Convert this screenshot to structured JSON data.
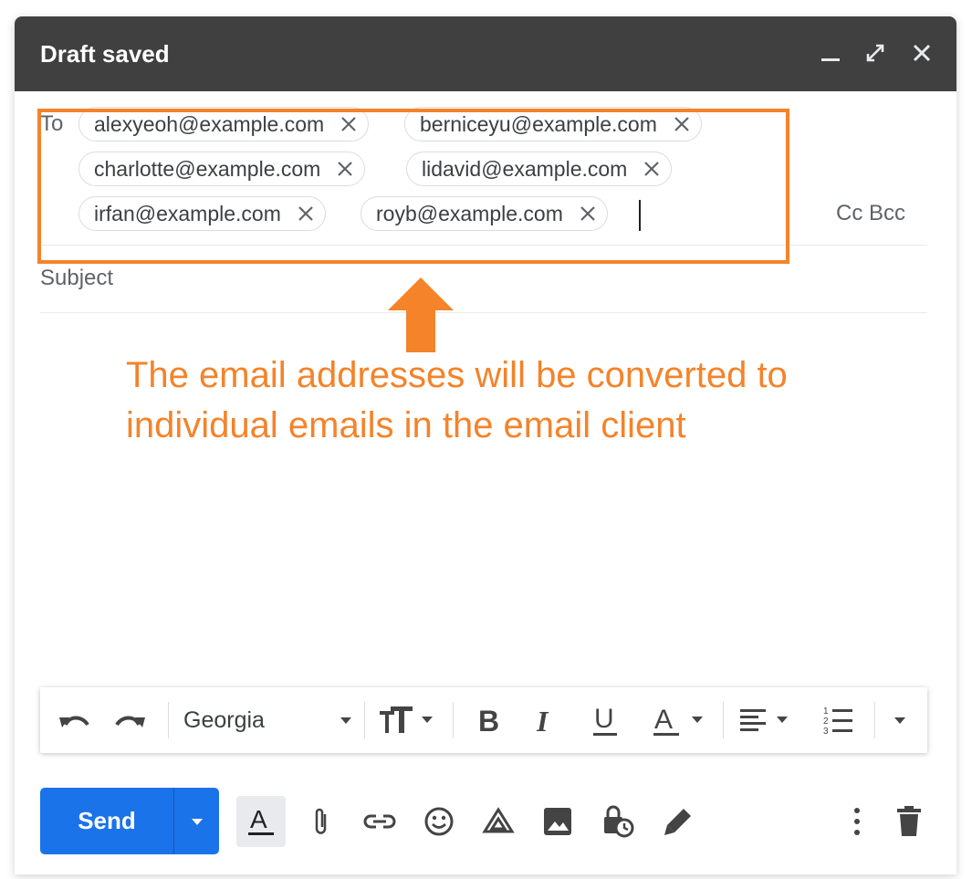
{
  "window": {
    "title": "Draft saved"
  },
  "recipients": {
    "to_label": "To",
    "chips": [
      "alexyeoh@example.com",
      "berniceyu@example.com",
      "charlotte@example.com",
      "lidavid@example.com",
      "irfan@example.com",
      "royb@example.com"
    ],
    "cc_label": "Cc",
    "bcc_label": "Bcc"
  },
  "subject": {
    "placeholder": "Subject"
  },
  "annotation": {
    "line1": "The email addresses will be converted to",
    "line2": "individual emails in the email client",
    "color": "#f4832a"
  },
  "formatting": {
    "font": "Georgia",
    "icons": [
      "undo-icon",
      "redo-icon",
      "text-size-icon",
      "bold-icon",
      "italic-icon",
      "underline-icon",
      "text-color-icon",
      "align-icon",
      "numbered-list-icon",
      "more-formatting-icon"
    ]
  },
  "actions": {
    "send_label": "Send",
    "accent": "#1a73e8",
    "icons": [
      "formatting-options-icon",
      "attach-icon",
      "link-icon",
      "emoji-icon",
      "drive-icon",
      "photo-icon",
      "confidential-icon",
      "signature-icon",
      "more-options-icon",
      "delete-icon"
    ]
  }
}
